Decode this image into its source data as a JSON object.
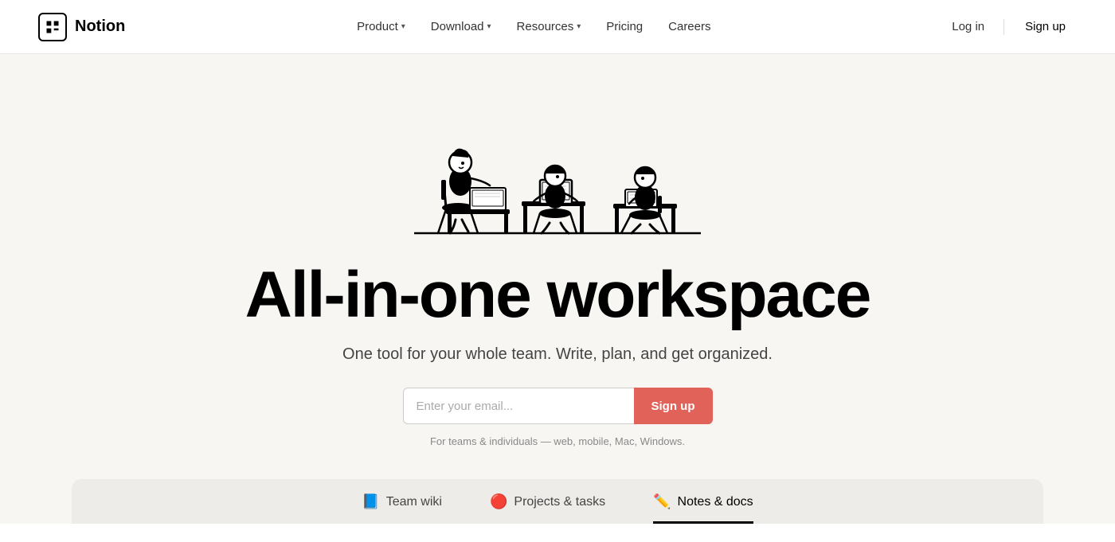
{
  "navbar": {
    "logo_text": "N",
    "brand_name": "Notion",
    "nav_items": [
      {
        "label": "Product",
        "has_chevron": true,
        "id": "product"
      },
      {
        "label": "Download",
        "has_chevron": true,
        "id": "download"
      },
      {
        "label": "Resources",
        "has_chevron": true,
        "id": "resources"
      },
      {
        "label": "Pricing",
        "has_chevron": false,
        "id": "pricing"
      },
      {
        "label": "Careers",
        "has_chevron": false,
        "id": "careers"
      }
    ],
    "login_label": "Log in",
    "signup_label": "Sign up"
  },
  "hero": {
    "headline": "All-in-one workspace",
    "subheadline": "One tool for your whole team. Write, plan, and get organized.",
    "email_placeholder": "Enter your email...",
    "signup_button_label": "Sign up",
    "note": "For teams & individuals — web, mobile, Mac, Windows."
  },
  "tabs": [
    {
      "emoji": "📘",
      "label": "Team wiki",
      "active": false
    },
    {
      "emoji": "🔴",
      "label": "Projects & tasks",
      "active": false
    },
    {
      "emoji": "✏️",
      "label": "Notes & docs",
      "active": true
    }
  ]
}
